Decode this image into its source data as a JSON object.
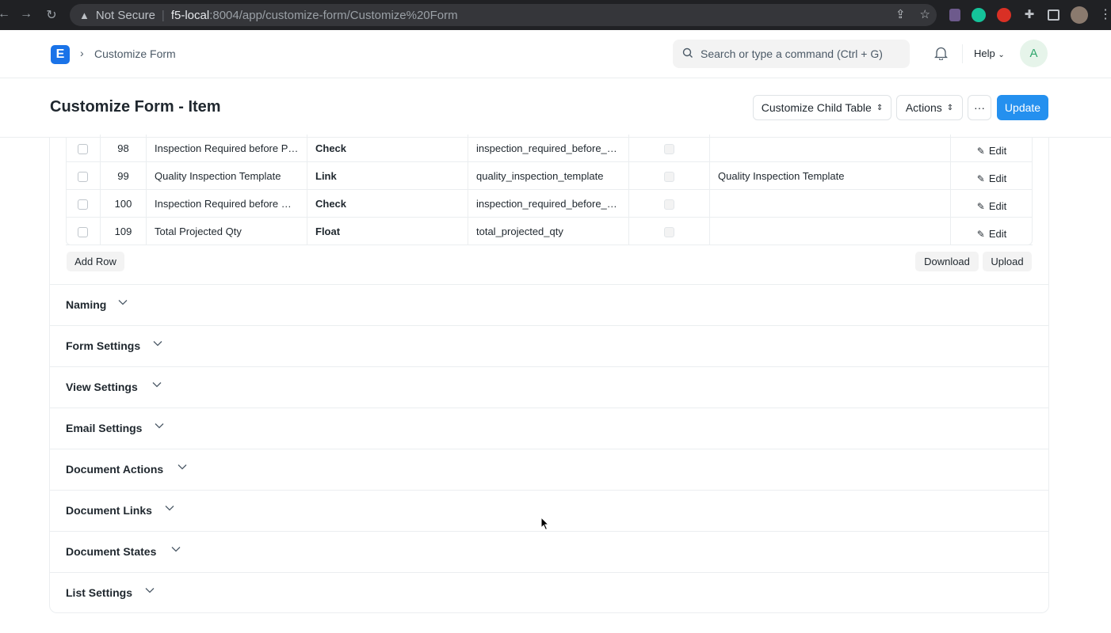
{
  "browser": {
    "not_secure": "Not Secure",
    "host": "f5-local",
    "path": ":8004/app/customize-form/Customize%20Form"
  },
  "navbar": {
    "breadcrumb": "Customize Form",
    "search_placeholder": "Search or type a command (Ctrl + G)",
    "help": "Help",
    "avatar_initial": "A"
  },
  "page": {
    "title": "Customize Form - Item",
    "buttons": {
      "customize_child_table": "Customize Child Table",
      "actions": "Actions",
      "more": "···",
      "update": "Update"
    }
  },
  "grid": {
    "rows": [
      {
        "idx": "98",
        "label": "Inspection Required before Pu...",
        "type": "Check",
        "fieldname": "inspection_required_before_p...",
        "options": "",
        "edit": "Edit"
      },
      {
        "idx": "99",
        "label": "Quality Inspection Template",
        "type": "Link",
        "fieldname": "quality_inspection_template",
        "options": "Quality Inspection Template",
        "edit": "Edit"
      },
      {
        "idx": "100",
        "label": "Inspection Required before De...",
        "type": "Check",
        "fieldname": "inspection_required_before_d...",
        "options": "",
        "edit": "Edit"
      },
      {
        "idx": "109",
        "label": "Total Projected Qty",
        "type": "Float",
        "fieldname": "total_projected_qty",
        "options": "",
        "edit": "Edit"
      }
    ],
    "add_row": "Add Row",
    "download": "Download",
    "upload": "Upload"
  },
  "sections": [
    "Naming",
    "Form Settings",
    "View Settings",
    "Email Settings",
    "Document Actions",
    "Document Links",
    "Document States",
    "List Settings"
  ]
}
